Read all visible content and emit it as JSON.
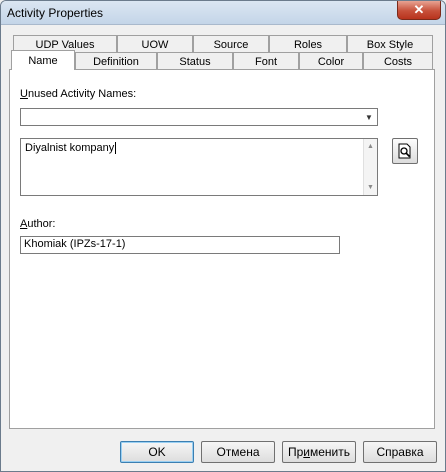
{
  "window": {
    "title": "Activity Properties",
    "close_glyph": "✕"
  },
  "tabs_back": [
    "UDP Values",
    "UOW",
    "Source",
    "Roles",
    "Box Style"
  ],
  "tabs_front": [
    "Name",
    "Definition",
    "Status",
    "Font",
    "Color",
    "Costs"
  ],
  "active_tab": "Name",
  "name_tab": {
    "unused_label_prefix": "U",
    "unused_label_rest": "nused Activity Names:",
    "unused_value": "",
    "name_value": "Diyalnist kompany",
    "author_label_prefix": "A",
    "author_label_rest": "uthor:",
    "author_value": "Khomiak (IPZs-17-1)"
  },
  "buttons": {
    "ok": "OK",
    "cancel": "Отмена",
    "apply_prefix": "Пр",
    "apply_u": "и",
    "apply_rest": "менить",
    "help": "Справка"
  },
  "icons": {
    "find": "find-icon",
    "close": "close-icon",
    "dropdown": "chevron-down-icon",
    "scroll_up": "scroll-up-icon",
    "scroll_down": "scroll-down-icon"
  }
}
